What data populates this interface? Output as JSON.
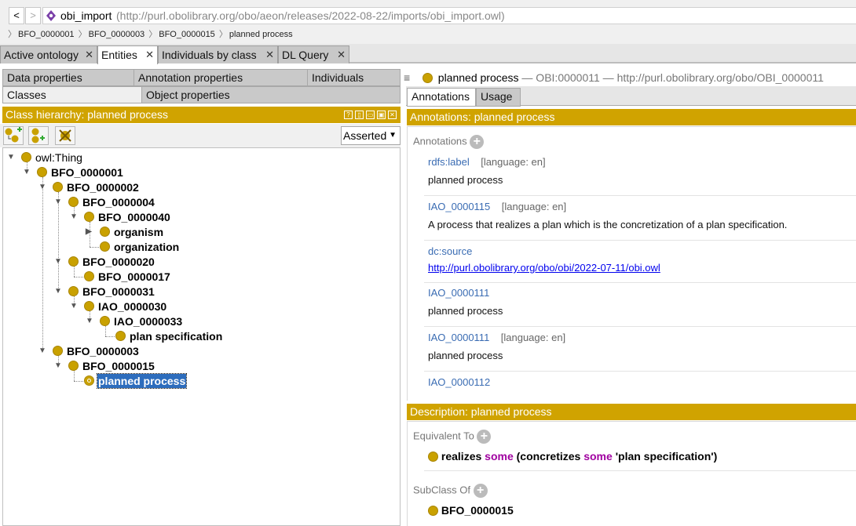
{
  "nav": {
    "back": "<",
    "forward": ">"
  },
  "address": {
    "entity_name": "obi_import",
    "iri": "(http://purl.obolibrary.org/obo/aeon/releases/2022-08-22/imports/obi_import.owl)"
  },
  "breadcrumb": [
    "BFO_0000001",
    "BFO_0000003",
    "BFO_0000015",
    "planned process"
  ],
  "main_tabs": [
    {
      "label": "Active ontology",
      "close": "✕"
    },
    {
      "label": "Entities",
      "close": "✕"
    },
    {
      "label": "Individuals by class",
      "close": "✕"
    },
    {
      "label": "DL Query",
      "close": "✕"
    }
  ],
  "entity_tabs": {
    "row1": [
      "Data properties",
      "Annotation properties",
      "Individuals"
    ],
    "row2": [
      "Classes",
      "Object properties"
    ]
  },
  "class_hierarchy": {
    "title": "Class hierarchy: planned process",
    "view_buttons": [
      "?",
      "▯",
      "▭",
      "▣",
      "✕"
    ],
    "mode": "Asserted",
    "tree": [
      "owl:Thing",
      "BFO_0000001",
      "BFO_0000002",
      "BFO_0000004",
      "BFO_0000040",
      "organism",
      "organization",
      "BFO_0000020",
      "BFO_0000017",
      "BFO_0000031",
      "IAO_0000030",
      "IAO_0000033",
      "plan specification",
      "BFO_0000003",
      "BFO_0000015",
      "planned process"
    ]
  },
  "entity_header": {
    "name": "planned process",
    "id": "— OBI:0000011 —",
    "iri": "http://purl.obolibrary.org/obo/OBI_0000011"
  },
  "right_tabs": [
    "Annotations",
    "Usage"
  ],
  "annotations": {
    "title": "Annotations: planned process",
    "section_label": "Annotations",
    "items": [
      {
        "key": "rdfs:label",
        "lang": "[language: en]",
        "value": "planned process"
      },
      {
        "key": "IAO_0000115",
        "lang": "[language: en]",
        "value": "A process that realizes a plan which is the concretization of a plan specification."
      },
      {
        "key": "dc:source",
        "lang": "",
        "value": "http://purl.obolibrary.org/obo/obi/2022-07-11/obi.owl"
      },
      {
        "key": "IAO_0000111",
        "lang": "",
        "value": "planned process"
      },
      {
        "key": "IAO_0000111",
        "lang": "[language: en]",
        "value": "planned process"
      },
      {
        "key": "IAO_0000112",
        "lang": "",
        "value": ""
      }
    ]
  },
  "description": {
    "title": "Description: planned process",
    "equivalent_label": "Equivalent To",
    "equivalent": {
      "p1": "realizes",
      "k1": "some",
      "p2": "(concretizes",
      "k2": "some",
      "p3": "'plan specification')"
    },
    "subclass_label": "SubClass Of",
    "subclass": "BFO_0000015"
  },
  "colors": {
    "accent": "#d0a300",
    "class_dot": "#c9a100",
    "selection": "#2d6dbd",
    "keyword": "#a000a0",
    "link": "#3a6cb3"
  }
}
